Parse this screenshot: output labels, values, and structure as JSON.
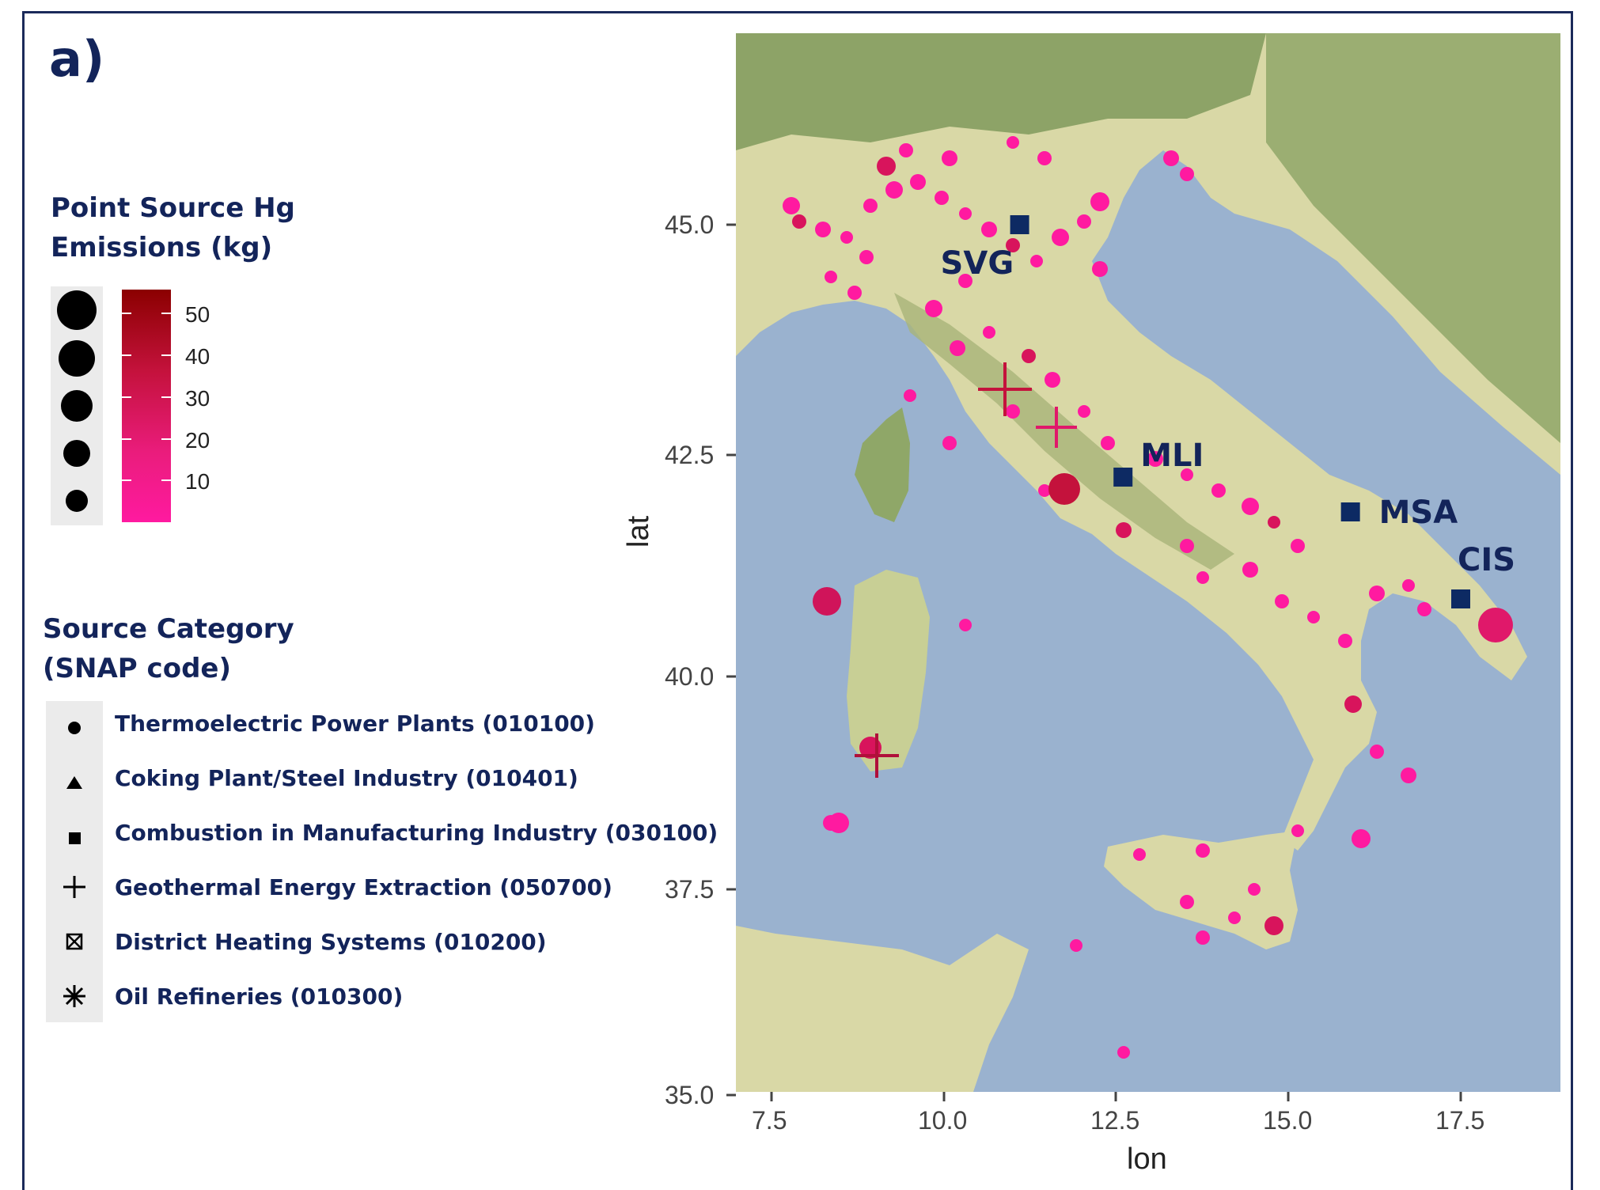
{
  "panel_label": "a)",
  "legend": {
    "size_title_line1": "Point Source  Hg",
    "size_title_line2": "Emissions (kg)",
    "color_ticks": [
      "50",
      "40",
      "30",
      "20",
      "10"
    ],
    "category_title_line1": "Source Category",
    "category_title_line2": "(SNAP code)",
    "categories": [
      {
        "label": "Thermoelectric Power Plants (010100)",
        "shape": "circle"
      },
      {
        "label": "Coking Plant/Steel Industry (010401)",
        "shape": "triangle"
      },
      {
        "label": "Combustion in Manufacturing Industry (030100)",
        "shape": "square"
      },
      {
        "label": "Geothermal Energy Extraction (050700)",
        "shape": "plus"
      },
      {
        "label": "District Heating Systems (010200)",
        "shape": "boxed-x"
      },
      {
        "label": "Oil Refineries (010300)",
        "shape": "asterisk"
      }
    ]
  },
  "axes": {
    "xlabel": "lon",
    "ylabel": "lat",
    "x_ticks": [
      "7.5",
      "10.0",
      "12.5",
      "15.0",
      "17.5"
    ],
    "y_ticks": [
      "45.0",
      "42.5",
      "40.0",
      "37.5",
      "35.0"
    ]
  },
  "colors": {
    "sea": "#9ab2cf",
    "land": "#d9d8a6",
    "mountain": "#7f9a5c",
    "emission_low": "#ff1aa0",
    "emission_high": "#8b0000",
    "station": "#0d2a63"
  },
  "stations": [
    {
      "code": "SVG",
      "lon": 11.1,
      "lat": 45.0
    },
    {
      "code": "MLI",
      "lon": 12.6,
      "lat": 42.1
    },
    {
      "code": "MSA",
      "lon": 15.9,
      "lat": 41.7
    },
    {
      "code": "CIS",
      "lon": 17.5,
      "lat": 40.7
    }
  ]
}
